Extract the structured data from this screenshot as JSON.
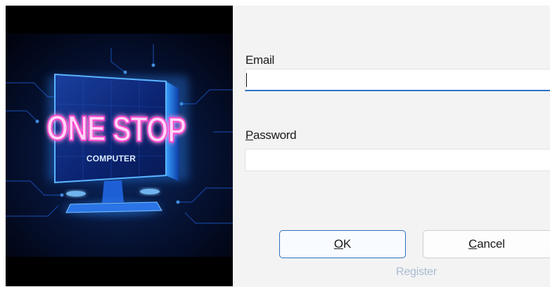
{
  "branding": {
    "line1": "ONE STOP",
    "line2": "COMPUTER"
  },
  "email": {
    "label": "Email",
    "value": ""
  },
  "password": {
    "label_mnemonic": "P",
    "label_rest": "assword",
    "value": ""
  },
  "buttons": {
    "ok_mnemonic": "O",
    "ok_rest": "K",
    "cancel_mnemonic": "C",
    "cancel_rest": "ancel"
  },
  "register_link": "Register",
  "colors": {
    "accent": "#2b72c9",
    "panel_background": "#f3f3f3",
    "link": "#a8bbd2",
    "neon_pink": "#ff3fd0",
    "neon_blue": "#2f8cff"
  }
}
